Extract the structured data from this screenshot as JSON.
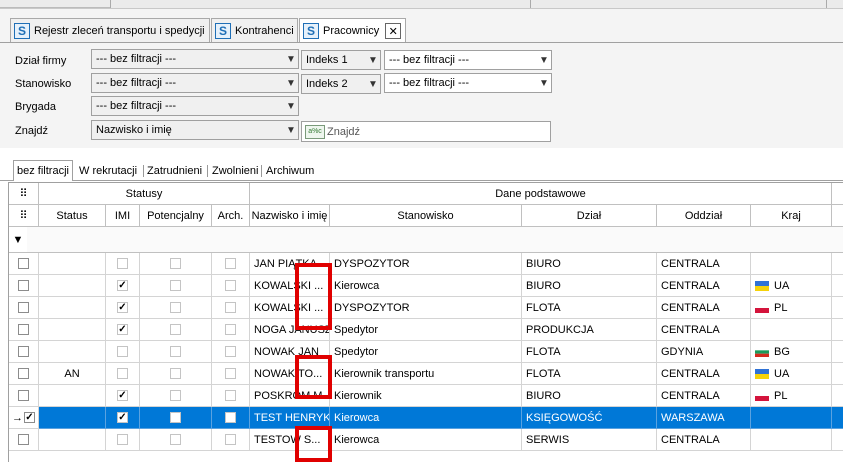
{
  "tabs": [
    {
      "label": "Rejestr zleceń transportu i spedycji",
      "icon": "s-app-icon"
    },
    {
      "label": "Kontrahenci",
      "icon": "s-app-icon"
    },
    {
      "label": "Pracownicy",
      "icon": "s-app-icon",
      "active": true,
      "close": "✕"
    }
  ],
  "filters": {
    "dzial": {
      "label": "Dział firmy",
      "value": "--- bez filtracji ---"
    },
    "stanowisko": {
      "label": "Stanowisko",
      "value": "--- bez filtracji ---"
    },
    "brygada": {
      "label": "Brygada",
      "value": "--- bez filtracji ---"
    },
    "znajdz": {
      "label": "Znajdź",
      "value": "Nazwisko i imię"
    },
    "indeks1": {
      "label": "Indeks 1",
      "value": "--- bez filtracji ---"
    },
    "indeks2": {
      "label": "Indeks 2",
      "value": "--- bez filtracji ---"
    },
    "search": {
      "placeholder": "Znajdź",
      "icon_text": "a%c"
    }
  },
  "filter_tabs": [
    "bez filtracji",
    "W rekrutacji",
    "Zatrudnieni",
    "Zwolnieni",
    "Archiwum"
  ],
  "grid": {
    "groups": {
      "statusy": "Statusy",
      "dane": "Dane podstawowe"
    },
    "columns": {
      "status": "Status",
      "imi": "IMI",
      "potencjalny": "Potencjalny",
      "arch": "Arch.",
      "nazwisko": "Nazwisko i imię",
      "stanowisko": "Stanowisko",
      "dzial": "Dział",
      "oddzial": "Oddział",
      "kraj": "Kraj"
    },
    "rows": [
      {
        "status": "",
        "imi": false,
        "name": "JAN PIĄTKA",
        "stanowisko": "DYSPOZYTOR",
        "dzial": "BIURO",
        "oddzial": "CENTRALA",
        "kraj": "",
        "flag": ""
      },
      {
        "status": "",
        "imi": true,
        "name": "KOWALSKI ...",
        "stanowisko": "Kierowca",
        "dzial": "BIURO",
        "oddzial": "CENTRALA",
        "kraj": "UA",
        "flag": "ua"
      },
      {
        "status": "",
        "imi": true,
        "name": "KOWALSKI ...",
        "stanowisko": "DYSPOZYTOR",
        "dzial": "FLOTA",
        "oddzial": "CENTRALA",
        "kraj": "PL",
        "flag": "pl"
      },
      {
        "status": "",
        "imi": true,
        "name": "NOGA JANUSZ",
        "stanowisko": "Spedytor",
        "dzial": "PRODUKCJA",
        "oddzial": "CENTRALA",
        "kraj": "",
        "flag": ""
      },
      {
        "status": "",
        "imi": false,
        "name": "NOWAK JAN",
        "stanowisko": "Spedytor",
        "dzial": "FLOTA",
        "oddzial": "GDYNIA",
        "kraj": "BG",
        "flag": "bg"
      },
      {
        "status": "AN",
        "imi": false,
        "name": "NOWAK TO...",
        "stanowisko": "Kierownik transportu",
        "dzial": "FLOTA",
        "oddzial": "CENTRALA",
        "kraj": "UA",
        "flag": "ua"
      },
      {
        "status": "",
        "imi": true,
        "name": "POSKROM M...",
        "stanowisko": "Kierownik",
        "dzial": "BIURO",
        "oddzial": "CENTRALA",
        "kraj": "PL",
        "flag": "pl"
      },
      {
        "status": "",
        "imi": true,
        "name": "TEST HENRYK",
        "stanowisko": "Kierowca",
        "dzial": "KSIĘGOWOŚĆ",
        "oddzial": "WARSZAWA",
        "kraj": "",
        "flag": "",
        "selected": true,
        "marker": "→",
        "selected_check": "✓"
      },
      {
        "status": "",
        "imi": false,
        "name": "TESTOW S...",
        "stanowisko": "Kierowca",
        "dzial": "SERWIS",
        "oddzial": "CENTRALA",
        "kraj": "",
        "flag": ""
      }
    ]
  },
  "colors": {
    "selection": "#0078d7",
    "highlight": "#e00000",
    "app_icon": "#1f6fb6"
  }
}
